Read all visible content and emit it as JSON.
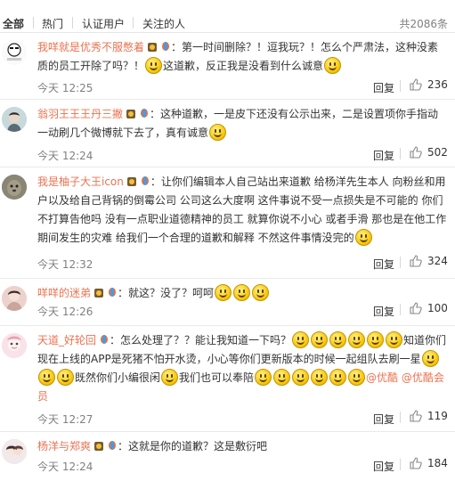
{
  "tabs": [
    {
      "label": "全部",
      "active": true
    },
    {
      "label": "热门",
      "active": false
    },
    {
      "label": "认证用户",
      "active": false
    },
    {
      "label": "关注的人",
      "active": false
    }
  ],
  "total_label": "共2086条",
  "reply_label": "回复",
  "icons": {
    "emoji": "smile-emoji-icon",
    "badge_a": "medal-badge-icon",
    "badge_b": "balloon-badge-icon",
    "like": "thumb-up-icon"
  },
  "colors": {
    "username": "#eb7350",
    "meta": "#808080",
    "divider": "#eaeaea"
  },
  "comments": [
    {
      "username": "我咩就是优秀不服憋着",
      "parts": [
        "：第一时间删除？！逗我玩？！怎么个严肃法，这种没素质的员工开除了吗？！",
        "这道歉，反正我是没看到什么诚意"
      ],
      "time": "今天 12:25",
      "likes": "236"
    },
    {
      "username": "翁羽王王王丹三撇",
      "parts": [
        "：这种道歉，一是皮下还没有公示出来，二是设置项你手指动一动刷几个微博就下去了，真有诚意"
      ],
      "time": "今天 12:24",
      "likes": "502"
    },
    {
      "username": "我是柚子大王icon",
      "parts": [
        "：让你们编辑本人自己站出来道歉  给杨洋先生本人 向粉丝和用户以及给自己背锅的倒霉公司 公司这么大度啊 这件事说不受一点损失是不可能的 你们不打算告他吗 没有一点职业道德精神的员工 就算你说不小心 或者手滑 那也是在他工作期间发生的灾难 给我们一个合理的道歉和解释 不然这件事情没完的"
      ],
      "time": "今天 12:32",
      "likes": "324"
    },
    {
      "username": "咩咩的迷弟",
      "parts": [
        "：就这？没了？呵呵"
      ],
      "time": "今天 12:26",
      "likes": "100"
    },
    {
      "username": "天道_好轮回",
      "parts": [
        "：怎么处理了？？能让我知道一下吗？",
        "知道你们现在上线的APP是死猪不怕开水烫，小心等你们更新版本的时候一起组队去刷一星",
        "既然你们小编很闲",
        "我们也可以奉陪",
        ""
      ],
      "mention": "@优酷 @优酷会员",
      "time": "今天 12:27",
      "likes": "119"
    },
    {
      "username": "杨洋与郑爽",
      "parts": [
        "：这就是你的道歉？这是敷衍吧"
      ],
      "time": "今天 12:24",
      "likes": "184"
    }
  ]
}
